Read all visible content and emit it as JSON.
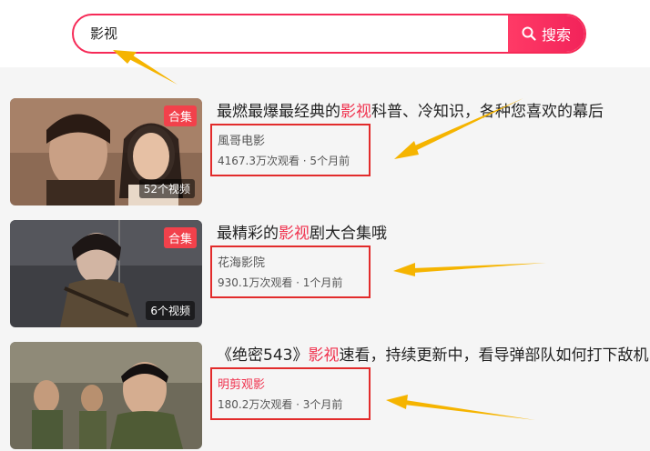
{
  "search": {
    "query": "影视",
    "button_label": "搜索"
  },
  "results": [
    {
      "title_pre": "最燃最爆最经典的",
      "title_hl": "影视",
      "title_post": "科普、冷知识，各种您喜欢的幕后",
      "badge": "合集",
      "count": "52个视频",
      "author": "風哥电影",
      "views": "4167.3万次观看 · 5个月前"
    },
    {
      "title_pre": "最精彩的",
      "title_hl": "影视",
      "title_post": "剧大合集哦",
      "badge": "合集",
      "count": "6个视频",
      "author": "花海影院",
      "views": "930.1万次观看 · 1个月前"
    },
    {
      "title_pre": "《绝密543》",
      "title_hl": "影视",
      "title_post": "速看，持续更新中，看导弹部队如何打下敌机",
      "badge": "",
      "count": "",
      "author": "明剪观影",
      "views": "180.2万次观看 · 3个月前"
    }
  ],
  "colors": {
    "accent": "#f62a57",
    "highlight": "#f0334f",
    "annotation_box": "#e22b2b",
    "arrow": "#f5b400"
  }
}
